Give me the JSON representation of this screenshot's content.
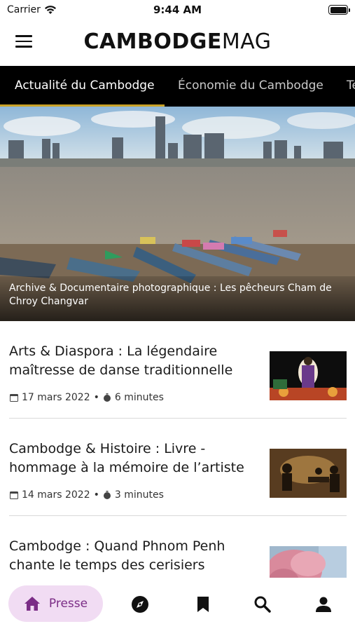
{
  "status_bar": {
    "carrier": "Carrier",
    "time": "9:44 AM"
  },
  "header": {
    "logo_bold": "CAMBODGE",
    "logo_light": "MAG"
  },
  "tabs": [
    {
      "label": "Actualité du Cambodge",
      "active": true
    },
    {
      "label": "Économie du Cambodge",
      "active": false
    },
    {
      "label": "Te",
      "active": false
    }
  ],
  "hero": {
    "caption": "Archive & Documentaire photographique : Les pêcheurs Cham de Chroy Changvar"
  },
  "articles": [
    {
      "title": "Arts & Diaspora : La légendaire maîtresse de danse traditionnelle",
      "date": "17 mars 2022",
      "separator": "•",
      "read_time": "6 minutes"
    },
    {
      "title": "Cambodge & Histoire : Livre - hommage à la mémoire de l’artiste",
      "date": "14 mars 2022",
      "separator": "•",
      "read_time": "3 minutes"
    },
    {
      "title": "Cambodge : Quand Phnom Penh chante le temps des cerisiers",
      "date": "",
      "separator": "",
      "read_time": ""
    }
  ],
  "bottom_nav": {
    "presse_label": "Presse",
    "items": [
      "home-icon",
      "compass-icon",
      "bookmark-icon",
      "search-icon",
      "person-icon"
    ]
  },
  "colors": {
    "accent": "#c9a227",
    "nav_pill": "#f1dcf3",
    "nav_active": "#7b2d86",
    "tab_bar": "#000000"
  }
}
